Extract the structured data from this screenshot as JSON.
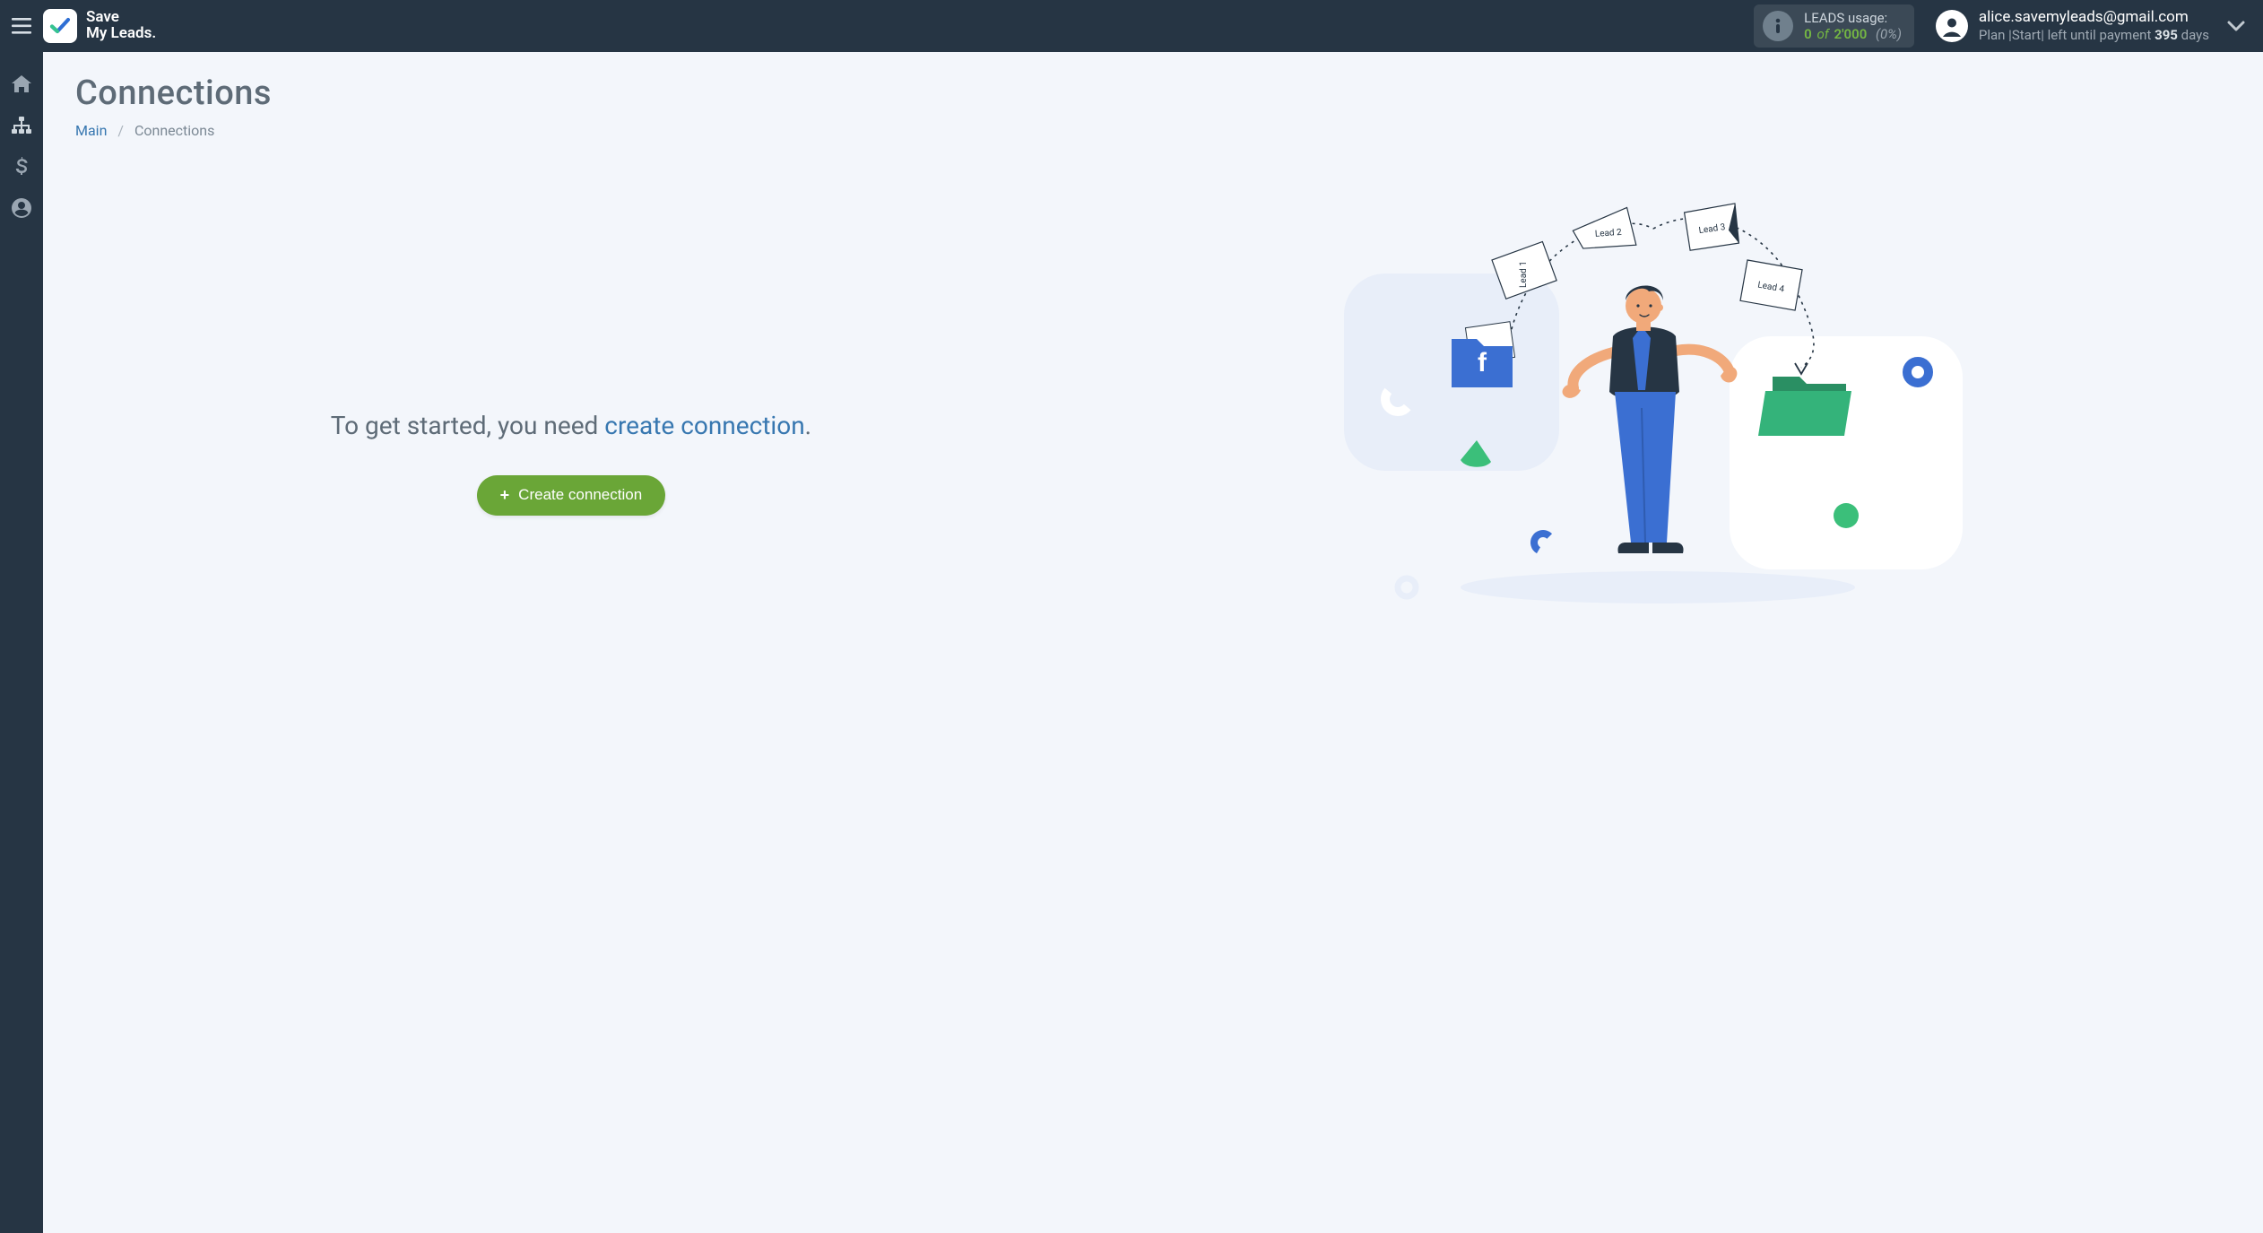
{
  "brand": {
    "line1": "Save",
    "line2": "My Leads."
  },
  "topbar": {
    "leads": {
      "title": "LEADS usage:",
      "used": "0",
      "of": "of",
      "total": "2'000",
      "pct": "(0%)"
    },
    "account": {
      "email": "alice.savemyleads@gmail.com",
      "plan_prefix": "Plan |",
      "plan_name": "Start",
      "plan_suffix_1": "| left until payment ",
      "days": "395",
      "plan_suffix_2": " days"
    }
  },
  "sidebar": {
    "items": [
      {
        "key": "home",
        "icon": "home",
        "label": "Home"
      },
      {
        "key": "connections",
        "icon": "sitemap",
        "label": "Connections"
      },
      {
        "key": "billing",
        "icon": "dollar",
        "label": "Billing"
      },
      {
        "key": "account",
        "icon": "user-circle",
        "label": "Account"
      }
    ]
  },
  "page": {
    "title": "Connections",
    "breadcrumb": {
      "root": "Main",
      "current": "Connections"
    },
    "hero": {
      "prefix": "To get started, you need ",
      "link": "create connection",
      "suffix": "."
    },
    "cta": "Create connection"
  },
  "illustration": {
    "leads": [
      "Lead 1",
      "Lead 2",
      "Lead 3",
      "Lead 4"
    ],
    "fb_letter": "f"
  }
}
